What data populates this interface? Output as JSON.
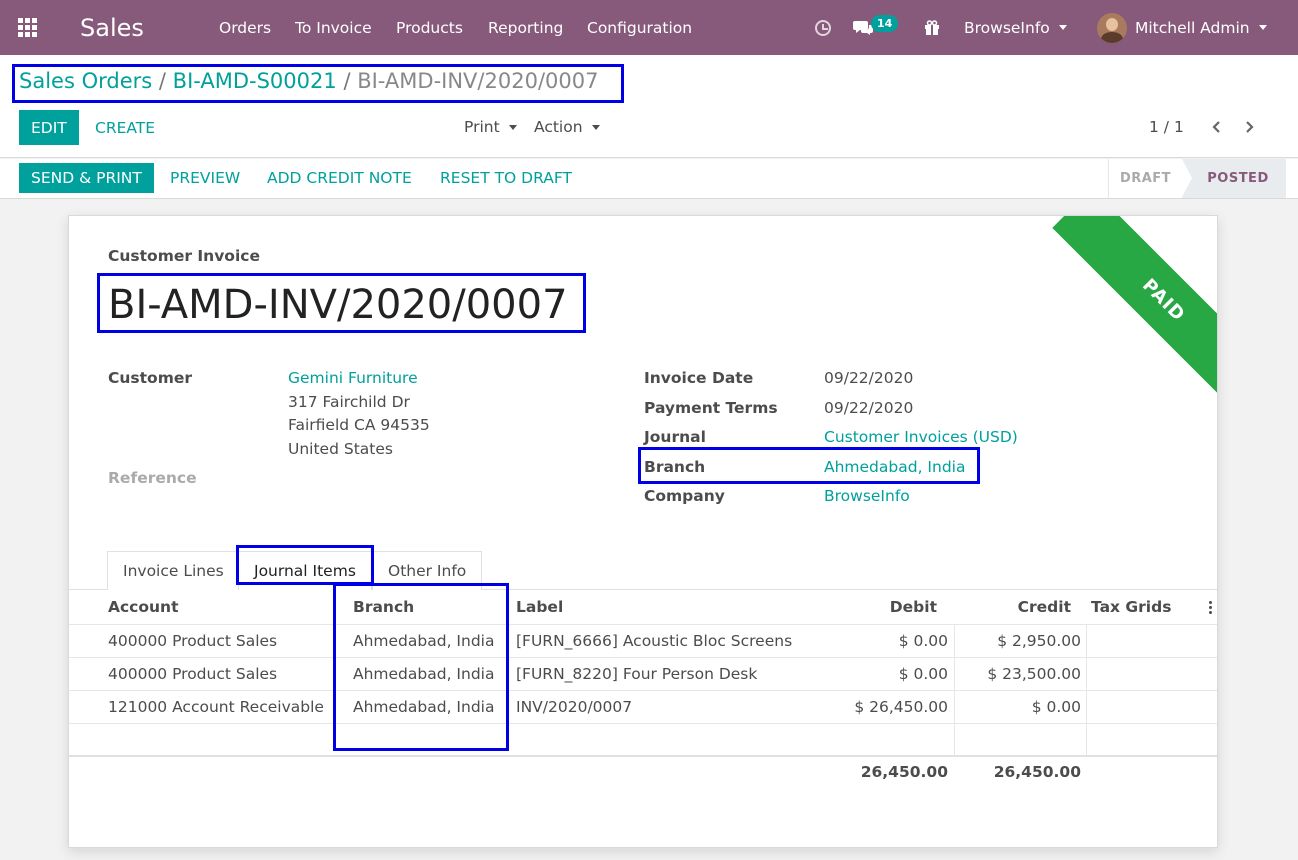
{
  "navbar": {
    "app_name": "Sales",
    "menu": [
      "Orders",
      "To Invoice",
      "Products",
      "Reporting",
      "Configuration"
    ],
    "messages_count": "14",
    "company": "BrowseInfo",
    "user": "Mitchell Admin"
  },
  "breadcrumb": {
    "root": "Sales Orders",
    "sep1": "/",
    "order": "BI-AMD-S00021",
    "sep2": "/",
    "current": "BI-AMD-INV/2020/0007"
  },
  "control": {
    "edit": "Edit",
    "create": "Create",
    "print": "Print",
    "action": "Action",
    "pager": "1 / 1"
  },
  "statusbar": {
    "buttons": [
      "Send & Print",
      "Preview",
      "Add Credit Note",
      "Reset to Draft"
    ],
    "stages": [
      "Draft",
      "Posted"
    ]
  },
  "invoice": {
    "ribbon": "PAID",
    "type_label": "Customer Invoice",
    "number": "BI-AMD-INV/2020/0007",
    "customer_label": "Customer",
    "customer_name": "Gemini Furniture",
    "address": [
      "317 Fairchild Dr",
      "Fairfield CA 94535",
      "United States"
    ],
    "reference_label": "Reference",
    "invoice_date_label": "Invoice Date",
    "invoice_date": "09/22/2020",
    "payment_terms_label": "Payment Terms",
    "payment_terms": "09/22/2020",
    "journal_label": "Journal",
    "journal": "Customer Invoices (USD)",
    "branch_label": "Branch",
    "branch": "Ahmedabad, India",
    "company_label": "Company",
    "company": "BrowseInfo"
  },
  "tabs": [
    "Invoice Lines",
    "Journal Items",
    "Other Info"
  ],
  "journal_items": {
    "columns": [
      "Account",
      "Branch",
      "Label",
      "Debit",
      "Credit",
      "Tax Grids"
    ],
    "rows": [
      {
        "account": "400000 Product Sales",
        "branch": "Ahmedabad, India",
        "label": "[FURN_6666] Acoustic Bloc Screens",
        "debit": "$ 0.00",
        "credit": "$ 2,950.00"
      },
      {
        "account": "400000 Product Sales",
        "branch": "Ahmedabad, India",
        "label": "[FURN_8220] Four Person Desk",
        "debit": "$ 0.00",
        "credit": "$ 23,500.00"
      },
      {
        "account": "121000 Account Receivable",
        "branch": "Ahmedabad, India",
        "label": "INV/2020/0007",
        "debit": "$ 26,450.00",
        "credit": "$ 0.00"
      }
    ],
    "total_debit": "26,450.00",
    "total_credit": "26,450.00"
  }
}
